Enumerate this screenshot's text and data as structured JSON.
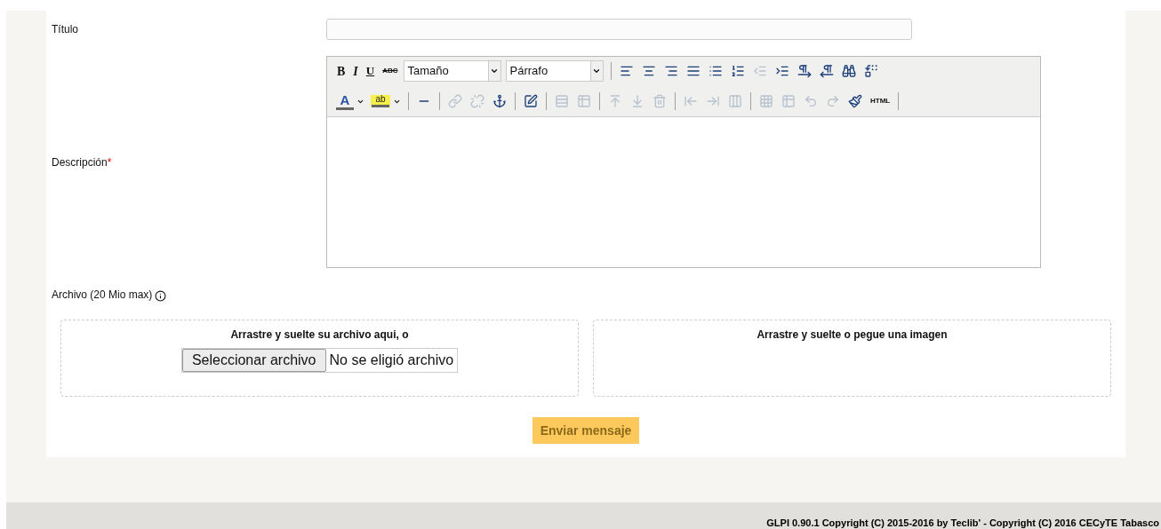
{
  "form": {
    "title_label": "Título",
    "description_label": "Descripción",
    "description_required_mark": "*",
    "toolbar": {
      "rows": [
        [
          {
            "kind": "text",
            "label": "B",
            "disabled": false
          },
          {
            "kind": "text",
            "label": "I",
            "disabled": false
          },
          {
            "kind": "text",
            "label": "U",
            "disabled": false
          },
          {
            "kind": "text",
            "label": "ABC",
            "disabled": false
          },
          {
            "kind": "select",
            "value": "Tamaño"
          },
          {
            "kind": "select",
            "value": "Párrafo"
          },
          {
            "kind": "separator"
          },
          {
            "kind": "icon",
            "disabled": false
          },
          {
            "kind": "icon",
            "disabled": false
          },
          {
            "kind": "icon",
            "disabled": false
          },
          {
            "kind": "icon",
            "disabled": false
          },
          {
            "kind": "icon",
            "disabled": false
          },
          {
            "kind": "icon",
            "disabled": false
          },
          {
            "kind": "icon",
            "disabled": true
          },
          {
            "kind": "icon",
            "disabled": false
          },
          {
            "kind": "icon",
            "disabled": false
          },
          {
            "kind": "icon",
            "disabled": false
          },
          {
            "kind": "icon",
            "disabled": false
          },
          {
            "kind": "icon",
            "disabled": false
          }
        ],
        [
          {
            "kind": "color",
            "label": "A",
            "disabled": false
          },
          {
            "kind": "color",
            "label": "ab",
            "disabled": false
          },
          {
            "kind": "separator"
          },
          {
            "kind": "icon",
            "disabled": false
          },
          {
            "kind": "separator"
          },
          {
            "kind": "icon",
            "disabled": true
          },
          {
            "kind": "icon",
            "disabled": true
          },
          {
            "kind": "icon",
            "disabled": false
          },
          {
            "kind": "separator"
          },
          {
            "kind": "icon",
            "disabled": false
          },
          {
            "kind": "separator"
          },
          {
            "kind": "icon",
            "disabled": true
          },
          {
            "kind": "icon",
            "disabled": true
          },
          {
            "kind": "separator"
          },
          {
            "kind": "icon",
            "disabled": true
          },
          {
            "kind": "icon",
            "disabled": true
          },
          {
            "kind": "icon",
            "disabled": true
          },
          {
            "kind": "separator"
          },
          {
            "kind": "icon",
            "disabled": true
          },
          {
            "kind": "icon",
            "disabled": true
          },
          {
            "kind": "icon",
            "disabled": true
          },
          {
            "kind": "separator"
          },
          {
            "kind": "icon",
            "disabled": true
          },
          {
            "kind": "icon",
            "disabled": true
          },
          {
            "kind": "icon",
            "disabled": true
          },
          {
            "kind": "icon",
            "disabled": true
          },
          {
            "kind": "icon",
            "disabled": false
          },
          {
            "kind": "text",
            "label": "HTML",
            "disabled": false
          },
          {
            "kind": "separator"
          }
        ]
      ]
    },
    "file_label": "Archivo (20 Mio max)",
    "dropzones": [
      {
        "kind": "file",
        "text": "Arrastre y suelte su archivo aqui, o",
        "button": "Seleccionar archivo",
        "status": "No se eligió archivo"
      },
      {
        "kind": "image",
        "text": "Arrastre y suelte o pegue una imagen"
      }
    ],
    "submit": "Enviar mensaje"
  },
  "footer": "GLPI 0.90.1 Copyright (C) 2015-2016 by Teclib' - Copyright (C) 2016 CECyTE Tabasco"
}
